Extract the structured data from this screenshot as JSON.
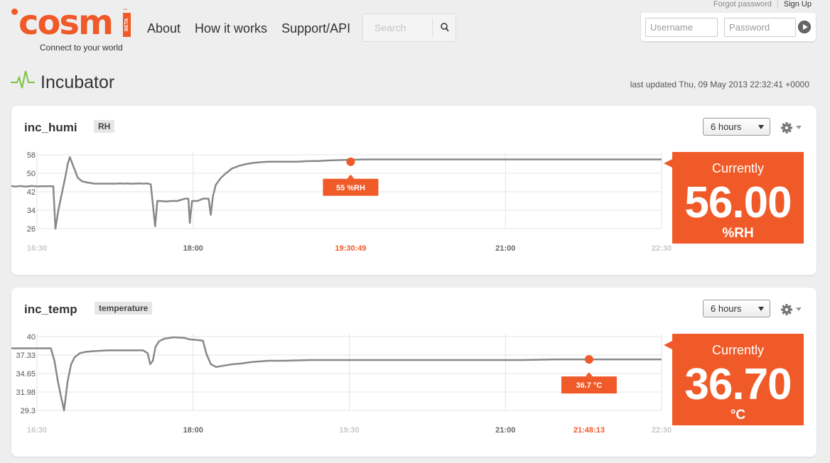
{
  "header": {
    "logo_text": "cosm",
    "logo_beta": "BETA",
    "logo_tm": "™",
    "tagline": "Connect to your world",
    "nav": [
      "About",
      "How it works",
      "Support/API"
    ],
    "search_placeholder": "Search",
    "forgot_password": "Forgot password",
    "sign_up": "Sign Up",
    "username_placeholder": "Username",
    "password_placeholder": "Password"
  },
  "page": {
    "title": "Incubator",
    "last_updated": "last updated Thu, 09 May 2013 22:32:41 +0000"
  },
  "colors": {
    "accent": "#f05a28",
    "line": "#888888",
    "pulse": "#7dc242"
  },
  "datastreams": [
    {
      "name": "inc_humi",
      "tag": "RH",
      "range": "6 hours",
      "current_label": "Currently",
      "current_value": "56.00",
      "current_unit": "%RH",
      "chart_data": {
        "type": "line",
        "y_ticks": [
          "58",
          "50",
          "42",
          "34",
          "26"
        ],
        "ylim": [
          26,
          58
        ],
        "x_ticks": [
          {
            "label": "16:30",
            "t": 0
          },
          {
            "label": "18:00",
            "t": 90
          },
          {
            "label": "19:30:49",
            "t": 180.8,
            "highlight": true
          },
          {
            "label": "21:00",
            "t": 270
          },
          {
            "label": "22:30",
            "t": 360
          }
        ],
        "xlim": [
          0,
          360
        ],
        "tooltip": {
          "t": 180.8,
          "y": 55,
          "label": "55 %RH"
        },
        "points": [
          [
            0,
            44.5
          ],
          [
            6,
            44.2
          ],
          [
            12,
            44.5
          ],
          [
            20,
            44.2
          ],
          [
            28,
            44.5
          ],
          [
            36,
            44.3
          ],
          [
            44,
            44.4
          ],
          [
            52,
            44.4
          ],
          [
            58,
            44.4
          ],
          [
            61,
            26
          ],
          [
            65,
            34
          ],
          [
            75,
            49
          ],
          [
            78,
            54
          ],
          [
            81,
            57
          ],
          [
            87,
            52
          ],
          [
            92,
            48
          ],
          [
            98,
            46.5
          ],
          [
            105,
            46
          ],
          [
            115,
            45.5
          ],
          [
            125,
            45.5
          ],
          [
            135,
            45.5
          ],
          [
            145,
            45.5
          ],
          [
            150,
            45.6
          ],
          [
            155,
            45.5
          ],
          [
            160,
            45.6
          ],
          [
            165,
            45.5
          ],
          [
            170,
            45.5
          ],
          [
            177,
            45.6
          ],
          [
            183,
            45.5
          ],
          [
            188,
            45.6
          ],
          [
            193,
            45.2
          ],
          [
            196,
            36
          ],
          [
            199,
            27
          ],
          [
            202,
            38
          ],
          [
            206,
            38
          ],
          [
            214,
            37.8
          ],
          [
            222,
            38
          ],
          [
            230,
            38
          ],
          [
            240,
            39
          ],
          [
            245,
            39
          ],
          [
            247,
            28.5
          ],
          [
            250,
            38
          ],
          [
            258,
            38
          ],
          [
            265,
            39
          ],
          [
            273,
            39
          ],
          [
            276,
            32
          ],
          [
            279,
            40
          ],
          [
            283,
            45
          ],
          [
            290,
            48
          ],
          [
            297,
            50
          ],
          [
            305,
            52
          ],
          [
            315,
            53.2
          ],
          [
            325,
            54
          ],
          [
            335,
            54.5
          ],
          [
            345,
            54.8
          ],
          [
            355,
            55
          ],
          [
            365,
            55
          ],
          [
            375,
            55
          ],
          [
            385,
            55
          ],
          [
            395,
            55
          ],
          [
            405,
            55.2
          ],
          [
            415,
            55.3
          ],
          [
            425,
            55.3
          ],
          [
            435,
            55.5
          ],
          [
            445,
            55.6
          ],
          [
            460,
            55.8
          ],
          [
            490,
            56
          ],
          [
            530,
            56
          ],
          [
            570,
            56
          ],
          [
            610,
            56
          ],
          [
            660,
            56
          ],
          [
            710,
            56
          ],
          [
            760,
            56
          ],
          [
            810,
            56
          ],
          [
            850,
            56
          ],
          [
            900,
            56
          ]
        ],
        "x_scale": "sample_index"
      }
    },
    {
      "name": "inc_temp",
      "tag": "temperature",
      "range": "6 hours",
      "current_label": "Currently",
      "current_value": "36.70",
      "current_unit": "°C",
      "chart_data": {
        "type": "line",
        "y_ticks": [
          "40",
          "37.33",
          "34.65",
          "31.98",
          "29.3"
        ],
        "ylim": [
          29.3,
          40
        ],
        "x_ticks": [
          {
            "label": "16:30",
            "t": 0
          },
          {
            "label": "18:00",
            "t": 90
          },
          {
            "label": "19:30",
            "t": 180
          },
          {
            "label": "21:00",
            "t": 270
          },
          {
            "label": "21:48:13",
            "t": 318.2,
            "highlight": true
          },
          {
            "label": "22:30",
            "t": 360
          }
        ],
        "xlim": [
          0,
          360
        ],
        "tooltip": {
          "t": 318.2,
          "y": 36.7,
          "label": "36.7 °C"
        },
        "points": [
          [
            0,
            38.3
          ],
          [
            10,
            38.3
          ],
          [
            20,
            38.3
          ],
          [
            30,
            38.3
          ],
          [
            40,
            38.3
          ],
          [
            45,
            38.3
          ],
          [
            49,
            36.5
          ],
          [
            53,
            33.5
          ],
          [
            57,
            31
          ],
          [
            60,
            29.3
          ],
          [
            64,
            33.5
          ],
          [
            68,
            36
          ],
          [
            72,
            37
          ],
          [
            78,
            37.6
          ],
          [
            85,
            37.8
          ],
          [
            95,
            37.9
          ],
          [
            110,
            38
          ],
          [
            125,
            38
          ],
          [
            140,
            38
          ],
          [
            150,
            38
          ],
          [
            155,
            37.6
          ],
          [
            158,
            36
          ],
          [
            161,
            36.5
          ],
          [
            164,
            38.5
          ],
          [
            168,
            39.3
          ],
          [
            174,
            39.7
          ],
          [
            185,
            39.9
          ],
          [
            197,
            39.8
          ],
          [
            203,
            39.6
          ],
          [
            212,
            39.5
          ],
          [
            218,
            39.4
          ],
          [
            222,
            37.5
          ],
          [
            227,
            36
          ],
          [
            233,
            35.6
          ],
          [
            242,
            35.8
          ],
          [
            252,
            36
          ],
          [
            262,
            36.1
          ],
          [
            272,
            36.3
          ],
          [
            282,
            36.4
          ],
          [
            292,
            36.5
          ],
          [
            310,
            36.5
          ],
          [
            340,
            36.6
          ],
          [
            380,
            36.6
          ],
          [
            420,
            36.6
          ],
          [
            460,
            36.6
          ],
          [
            500,
            36.6
          ],
          [
            540,
            36.6
          ],
          [
            580,
            36.6
          ],
          [
            620,
            36.7
          ],
          [
            660,
            36.7
          ],
          [
            700,
            36.7
          ],
          [
            740,
            36.7
          ]
        ],
        "x_scale": "sample_index"
      }
    }
  ]
}
